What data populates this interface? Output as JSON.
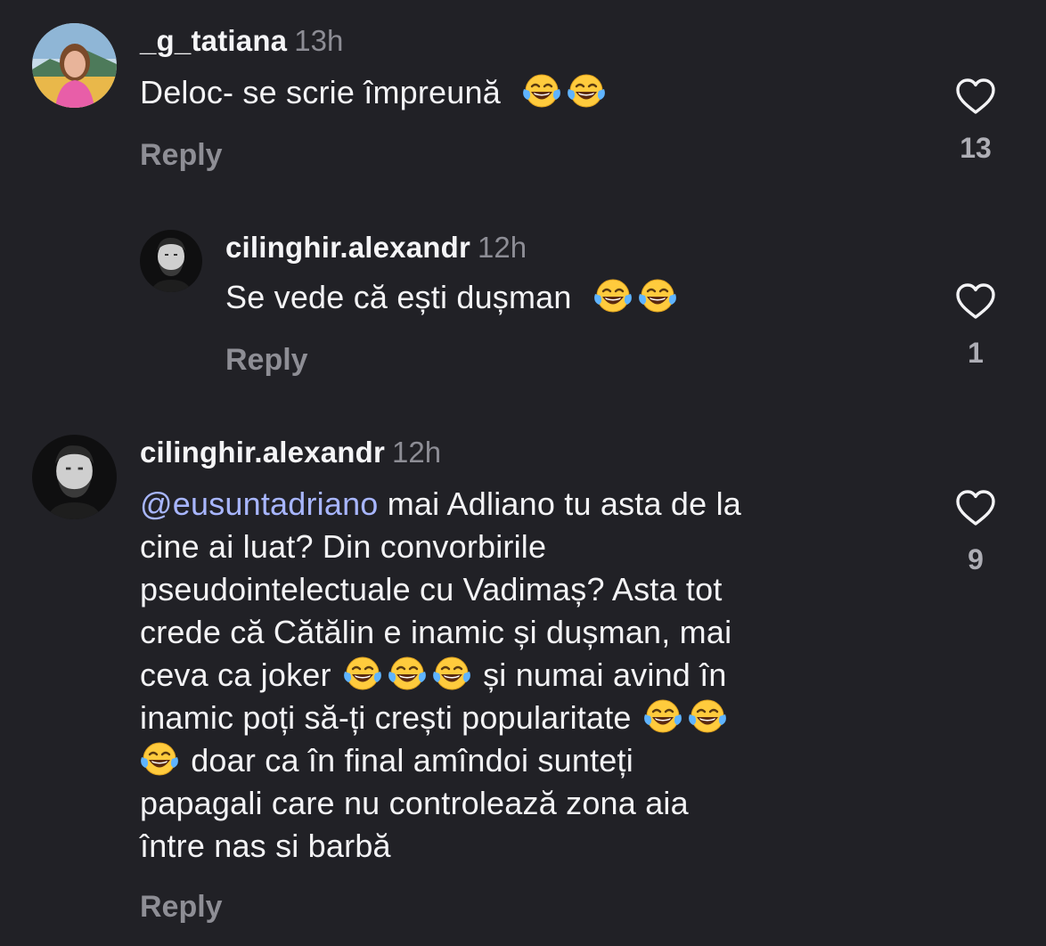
{
  "comments": [
    {
      "username": "_g_tatiana",
      "time": "13h",
      "text": "Deloc- se scrie împreună",
      "reply_label": "Reply",
      "likes": "13"
    },
    {
      "username": "cilinghir.alexandr",
      "time": "12h",
      "text": "Se vede că ești dușman",
      "reply_label": "Reply",
      "likes": "1"
    },
    {
      "username": "cilinghir.alexandr",
      "time": "12h",
      "mention": "@eusuntadriano",
      "lines": {
        "l1": "mai Adliano tu asta de la",
        "l2": "cine ai luat? Din convorbirile",
        "l3": "pseudointelectuale cu Vadimaș? Asta tot",
        "l4": "crede că Cătălin e inamic și dușman, mai",
        "l5a": "ceva ca joker",
        "l5b": "și numai avind în",
        "l6": "inamic poți să-ți crești popularitate",
        "l7": "doar ca în final amîndoi sunteți",
        "l8": "papagali care nu controlează zona aia",
        "l9": "între nas si barbă"
      },
      "reply_label": "Reply",
      "likes": "9"
    }
  ],
  "icons": {
    "emoji": "face-with-tears-of-joy-icon",
    "like": "heart-outline-icon"
  },
  "colors": {
    "background": "#212126",
    "text": "#f3f3f5",
    "muted": "#8e8e95",
    "mention": "#a8b6ff"
  }
}
